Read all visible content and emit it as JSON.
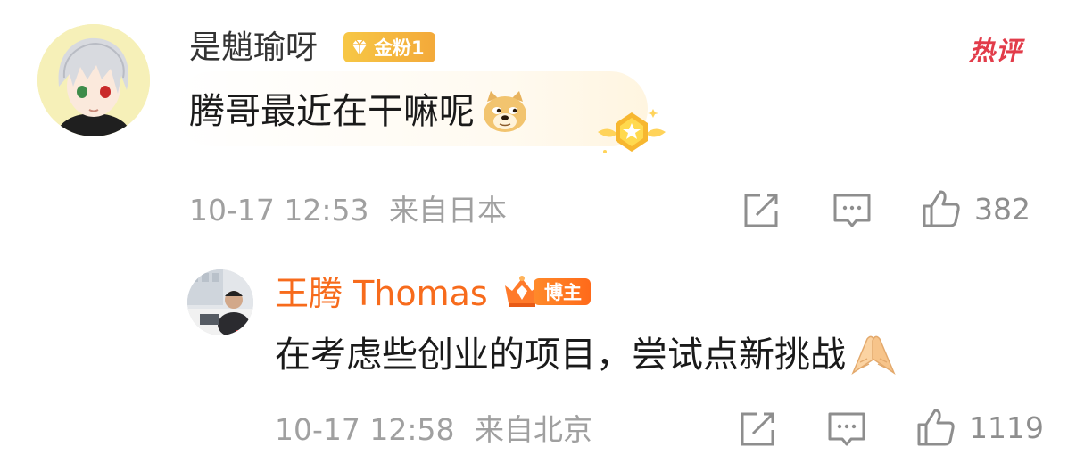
{
  "comments": [
    {
      "username": "是魈瑜呀",
      "fan_badge": "金粉1",
      "hot_tag": "热评",
      "text": "腾哥最近在干嘛呢",
      "emoji": "doge-emoji",
      "time": "10-17 12:53",
      "location": "来自日本",
      "like_count": "382"
    }
  ],
  "reply": {
    "username": "王腾 Thomas",
    "role_badge": "博主",
    "text": "在考虑些创业的项目，尝试点新挑战",
    "emoji": "pressed-palms-emoji",
    "time": "10-17 12:58",
    "location": "来自北京",
    "like_count": "1119"
  },
  "icons": [
    "share-icon",
    "comment-icon",
    "like-icon"
  ],
  "colors": {
    "reply_name": "#f76b1c",
    "hot_tag": "#e23c4a",
    "meta_text": "#a0a0a0",
    "gold": "#f7c745"
  }
}
